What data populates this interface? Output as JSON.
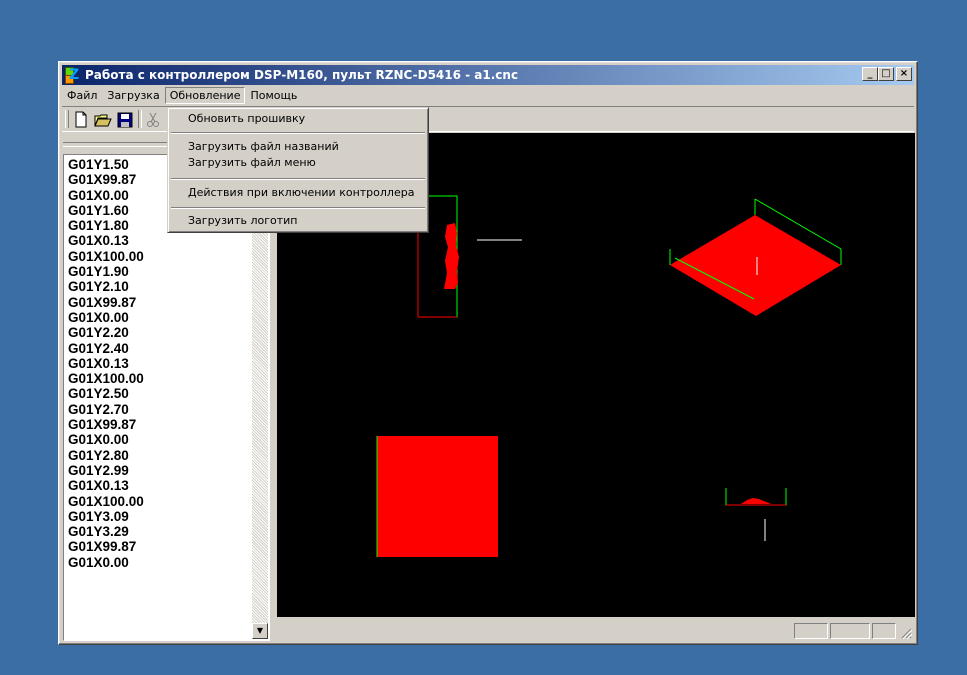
{
  "window": {
    "title": "Работа с контроллером DSP-M160, пульт RZNC-D5416 - a1.cnc",
    "minimize_label": "_",
    "maximize_label": "□",
    "close_label": "×"
  },
  "menubar": {
    "items": [
      {
        "label": "Файл"
      },
      {
        "label": "Загрузка"
      },
      {
        "label": "Обновление"
      },
      {
        "label": "Помощь"
      }
    ]
  },
  "dropdown": {
    "items": [
      {
        "label": "Обновить прошивку"
      },
      {
        "label": "Загрузить файл названий"
      },
      {
        "label": "Загрузить файл меню"
      },
      {
        "label": "Действия при включении контроллера"
      },
      {
        "label": "Загрузить логотип"
      }
    ]
  },
  "gcode_list": {
    "lines": [
      "G01Y1.50",
      "G01X99.87",
      "G01X0.00",
      "G01Y1.60",
      "G01Y1.80",
      "G01X0.13",
      "G01X100.00",
      "G01Y1.90",
      "G01Y2.10",
      "G01X99.87",
      "G01X0.00",
      "G01Y2.20",
      "G01Y2.40",
      "G01X0.13",
      "G01X100.00",
      "G01Y2.50",
      "G01Y2.70",
      "G01X99.87",
      "G01X0.00",
      "G01Y2.80",
      "G01Y2.99",
      "G01X0.13",
      "G01X100.00",
      "G01Y3.09",
      "G01Y3.29",
      "G01X99.87",
      "G01X0.00"
    ]
  },
  "colors": {
    "desktop": "#3a6ea5",
    "canvas": "#000000",
    "fill": "#ff0000",
    "outline_green": "#00ff00",
    "marker": "#ffffff"
  },
  "toolbar": {
    "icons": [
      "new-file-icon",
      "open-folder-icon",
      "save-icon",
      "cut-icon"
    ]
  }
}
